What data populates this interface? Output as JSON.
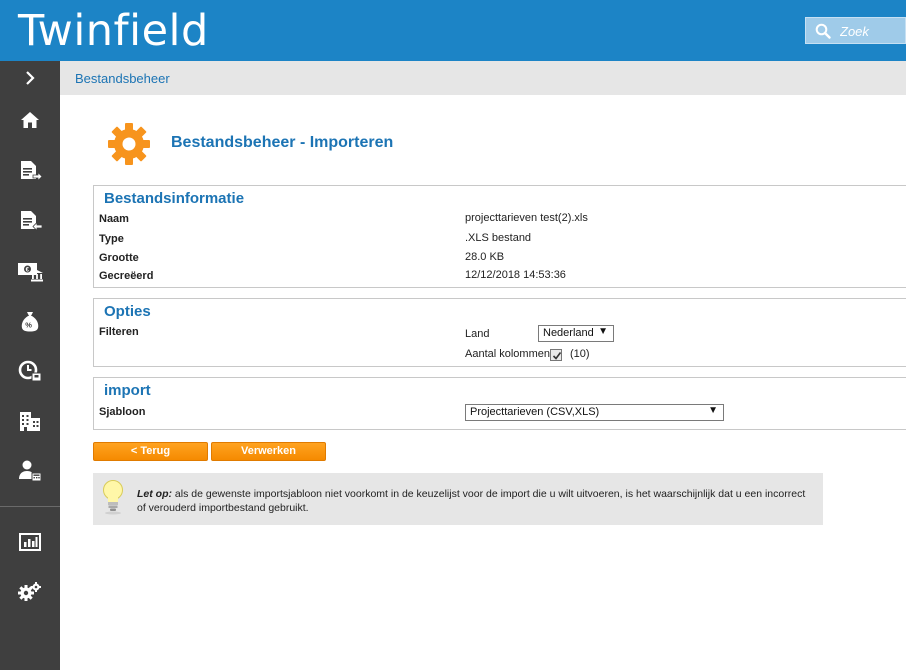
{
  "header": {
    "logo": "Twinfield",
    "search_placeholder": "Zoek"
  },
  "sidebar": {
    "items": [
      {
        "name": "expand-chevron-icon"
      },
      {
        "name": "home-icon"
      },
      {
        "name": "sales-invoice-icon"
      },
      {
        "name": "purchase-invoice-icon"
      },
      {
        "name": "bank-cash-icon"
      },
      {
        "name": "money-bag-icon"
      },
      {
        "name": "time-expenses-icon"
      },
      {
        "name": "company-building-icon"
      },
      {
        "name": "user-accounts-icon"
      },
      {
        "name": "reports-chart-icon"
      },
      {
        "name": "settings-gears-icon"
      }
    ]
  },
  "breadcrumb": "Bestandsbeheer",
  "page": {
    "title": "Bestandsbeheer - Importeren"
  },
  "bestandsinformatie": {
    "title": "Bestandsinformatie",
    "rows": [
      {
        "label": "Naam",
        "value": "projecttarieven test(2).xls"
      },
      {
        "label": "Type",
        "value": ".XLS bestand"
      },
      {
        "label": "Grootte",
        "value": "28.0 KB"
      },
      {
        "label": "Gecreëerd",
        "value": "12/12/2018 14:53:36"
      }
    ]
  },
  "opties": {
    "title": "Opties",
    "filter_label": "Filteren",
    "land_label": "Land",
    "land_value": "Nederland",
    "kolommen_label": "Aantal kolommen",
    "kolommen_checked": true,
    "kolommen_count": "(10)"
  },
  "import": {
    "title": "import",
    "sjabloon_label": "Sjabloon",
    "sjabloon_value": "Projecttarieven (CSV,XLS)"
  },
  "buttons": {
    "back": "< Terug",
    "process": "Verwerken"
  },
  "tip": {
    "lead": "Let op:",
    "text": "als de gewenste importsjabloon niet voorkomt in de keuzelijst voor de import die u wilt uitvoeren, is het waarschijnlijk dat u een incorrect of verouderd importbestand gebruikt."
  },
  "colors": {
    "brand_blue": "#1c84c6",
    "link_blue": "#1c74b4",
    "sidebar_bg": "#3f3f3f",
    "accent_orange": "#f7941d"
  }
}
